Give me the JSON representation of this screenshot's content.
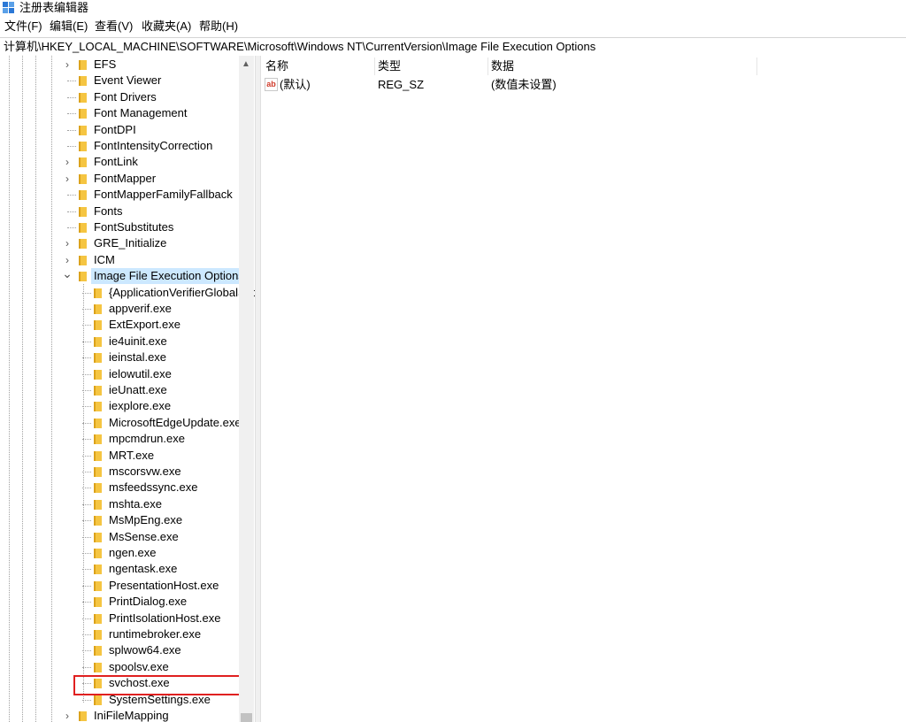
{
  "window": {
    "title": "注册表编辑器"
  },
  "menu": [
    "文件(F)",
    "编辑(E)",
    "查看(V)",
    "收藏夹(A)",
    "帮助(H)"
  ],
  "address": "计算机\\HKEY_LOCAL_MACHINE\\SOFTWARE\\Microsoft\\Windows NT\\CurrentVersion\\Image File Execution Options",
  "tree": [
    {
      "label": "EFS",
      "level": 1,
      "expander": "collapsed"
    },
    {
      "label": "Event Viewer",
      "level": 1,
      "expander": "none"
    },
    {
      "label": "Font Drivers",
      "level": 1,
      "expander": "none"
    },
    {
      "label": "Font Management",
      "level": 1,
      "expander": "none"
    },
    {
      "label": "FontDPI",
      "level": 1,
      "expander": "none"
    },
    {
      "label": "FontIntensityCorrection",
      "level": 1,
      "expander": "none"
    },
    {
      "label": "FontLink",
      "level": 1,
      "expander": "collapsed"
    },
    {
      "label": "FontMapper",
      "level": 1,
      "expander": "collapsed"
    },
    {
      "label": "FontMapperFamilyFallback",
      "level": 1,
      "expander": "none"
    },
    {
      "label": "Fonts",
      "level": 1,
      "expander": "none"
    },
    {
      "label": "FontSubstitutes",
      "level": 1,
      "expander": "none"
    },
    {
      "label": "GRE_Initialize",
      "level": 1,
      "expander": "collapsed"
    },
    {
      "label": "ICM",
      "level": 1,
      "expander": "collapsed"
    },
    {
      "label": "Image File Execution Options",
      "level": 1,
      "expander": "expanded",
      "selected": true
    },
    {
      "label": "{ApplicationVerifierGlobalSettings}",
      "level": 2,
      "expander": "none"
    },
    {
      "label": "appverif.exe",
      "level": 2,
      "expander": "none"
    },
    {
      "label": "ExtExport.exe",
      "level": 2,
      "expander": "none"
    },
    {
      "label": "ie4uinit.exe",
      "level": 2,
      "expander": "none"
    },
    {
      "label": "ieinstal.exe",
      "level": 2,
      "expander": "none"
    },
    {
      "label": "ielowutil.exe",
      "level": 2,
      "expander": "none"
    },
    {
      "label": "ieUnatt.exe",
      "level": 2,
      "expander": "none"
    },
    {
      "label": "iexplore.exe",
      "level": 2,
      "expander": "none"
    },
    {
      "label": "MicrosoftEdgeUpdate.exe",
      "level": 2,
      "expander": "none"
    },
    {
      "label": "mpcmdrun.exe",
      "level": 2,
      "expander": "none"
    },
    {
      "label": "MRT.exe",
      "level": 2,
      "expander": "none"
    },
    {
      "label": "mscorsvw.exe",
      "level": 2,
      "expander": "none"
    },
    {
      "label": "msfeedssync.exe",
      "level": 2,
      "expander": "none"
    },
    {
      "label": "mshta.exe",
      "level": 2,
      "expander": "none"
    },
    {
      "label": "MsMpEng.exe",
      "level": 2,
      "expander": "none"
    },
    {
      "label": "MsSense.exe",
      "level": 2,
      "expander": "none"
    },
    {
      "label": "ngen.exe",
      "level": 2,
      "expander": "none"
    },
    {
      "label": "ngentask.exe",
      "level": 2,
      "expander": "none"
    },
    {
      "label": "PresentationHost.exe",
      "level": 2,
      "expander": "none"
    },
    {
      "label": "PrintDialog.exe",
      "level": 2,
      "expander": "none"
    },
    {
      "label": "PrintIsolationHost.exe",
      "level": 2,
      "expander": "none"
    },
    {
      "label": "runtimebroker.exe",
      "level": 2,
      "expander": "none"
    },
    {
      "label": "splwow64.exe",
      "level": 2,
      "expander": "none"
    },
    {
      "label": "spoolsv.exe",
      "level": 2,
      "expander": "none"
    },
    {
      "label": "svchost.exe",
      "level": 2,
      "expander": "none",
      "highlighted": true
    },
    {
      "label": "SystemSettings.exe",
      "level": 2,
      "expander": "none"
    },
    {
      "label": "IniFileMapping",
      "level": 1,
      "expander": "collapsed"
    }
  ],
  "list": {
    "columns": [
      "名称",
      "类型",
      "数据"
    ],
    "rows": [
      {
        "name": "(默认)",
        "type": "REG_SZ",
        "data": "(数值未设置)",
        "icon": "string-value-icon",
        "icon_text": "ab"
      }
    ]
  },
  "colors": {
    "selection": "#cce8ff",
    "highlight_box": "#e02020",
    "folder": "#f5c542"
  }
}
